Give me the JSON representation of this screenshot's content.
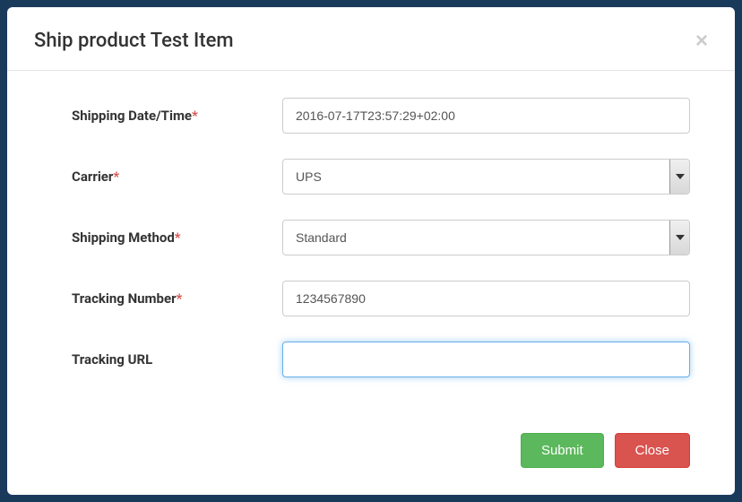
{
  "modal": {
    "title": "Ship product Test Item",
    "close_x": "×"
  },
  "form": {
    "shipping_date": {
      "label": "Shipping Date/Time",
      "value": "2016-07-17T23:57:29+02:00",
      "required": true
    },
    "carrier": {
      "label": "Carrier",
      "value": "UPS",
      "required": true
    },
    "shipping_method": {
      "label": "Shipping Method",
      "value": "Standard",
      "required": true
    },
    "tracking_number": {
      "label": "Tracking Number",
      "value": "1234567890",
      "required": true
    },
    "tracking_url": {
      "label": "Tracking URL",
      "value": "",
      "required": false
    }
  },
  "buttons": {
    "submit": "Submit",
    "close": "Close"
  },
  "required_mark": "*"
}
